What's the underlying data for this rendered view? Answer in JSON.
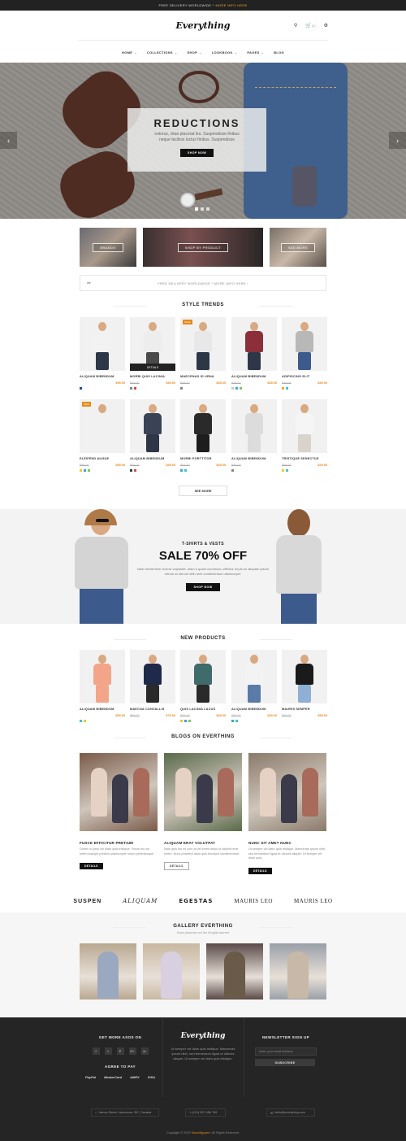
{
  "topbar": {
    "text": "FREE DELIVERY WORLDWIDE *",
    "link": "MORE INFO HERE"
  },
  "header": {
    "logo": "Everything",
    "cart_count": "(0)"
  },
  "nav": {
    "items": [
      {
        "label": "HOME",
        "caret": "⌄"
      },
      {
        "label": "COLLECTIONS",
        "caret": "⌄"
      },
      {
        "label": "SHOP",
        "caret": "⌄"
      },
      {
        "label": "LOOKBOOK",
        "caret": "⌄"
      },
      {
        "label": "PAGES",
        "caret": "⌄"
      },
      {
        "label": "BLOG",
        "caret": ""
      }
    ]
  },
  "hero": {
    "title": "REDUCTIONS",
    "subtitle": "ontorus, vitae placerat leo. Suspendisse finibus neque facilisis luctus finibus. Suspendisse",
    "button": "SHOP NOW"
  },
  "banners": [
    "BRANDS",
    "SHOP BY PRODUCT",
    "SEE MORE"
  ],
  "freebar": "FREE DELIVERY WORLDWIDE * MORE INFO HERE ›",
  "style_trends": {
    "title": "STYLE TRENDS",
    "products": [
      {
        "name": "ALIQUAM BIBENDUM",
        "old": "",
        "price": "$99.00",
        "badge": "",
        "swatches": [
          "#1f4aa8"
        ],
        "shirt": "#f2f2f2",
        "pants": "#2d3748"
      },
      {
        "name": "MORBI QUIS LACINIA",
        "old": "$49.00",
        "price": "$39.00",
        "badge": "",
        "swatches": [
          "#888888",
          "#d14b4b"
        ],
        "shirt": "#ededed",
        "pants": "#4a4a4a",
        "details": "DETAILS"
      },
      {
        "name": "MAECENAS ID URNA",
        "old": "$49.00",
        "price": "$39.00",
        "badge": "SALE",
        "swatches": [
          "#888888"
        ],
        "shirt": "#e8e8e8",
        "pants": "#2d3748"
      },
      {
        "name": "ALIQUAM BIBENDUM",
        "old": "$49.00",
        "price": "$39.00",
        "badge": "",
        "swatches": [
          "#cccccc",
          "#3fa3d3",
          "#7ac76d"
        ],
        "shirt": "#8c2f3b",
        "pants": "#2d3748"
      },
      {
        "name": "ADIPISCING ELIT",
        "old": "$49.00",
        "price": "$39.00",
        "badge": "",
        "swatches": [
          "#f0a830",
          "#3fc5c5"
        ],
        "shirt": "#b8b8b8",
        "pants": "#3d5a8c"
      },
      {
        "name": "ELEIFEND AUGUE",
        "old": "$99.00",
        "price": "$99.00",
        "badge": "NEW",
        "swatches": [
          "#f0c930",
          "#3fa3d3",
          "#7ac76d"
        ],
        "shirt": "#f1f1f1",
        "pants": "#f1f1f1"
      },
      {
        "name": "ALIQUAM BIBENDUM",
        "old": "$49.00",
        "price": "$39.00",
        "badge": "",
        "swatches": [
          "#3a3a3a",
          "#d14b4b"
        ],
        "shirt": "#3a4256",
        "pants": "#2d3748"
      },
      {
        "name": "MORBI PORTTITOR",
        "old": "$49.00",
        "price": "$39.00",
        "badge": "",
        "swatches": [
          "#3fa3d3",
          "#3fc5c5"
        ],
        "shirt": "#2a2a2a",
        "pants": "#1e1e1e"
      },
      {
        "name": "ALIQUAM BIBENDUM",
        "old": "$49.00",
        "price": "",
        "badge": "",
        "swatches": [
          "#888888"
        ],
        "shirt": "#dcdcdc",
        "pants": "#dcdcdc"
      },
      {
        "name": "TRISTIQUE SENECTUS",
        "old": "$49.00",
        "price": "$29.00",
        "badge": "",
        "swatches": [
          "#f0c930",
          "#3fc5c5"
        ],
        "shirt": "#f5f5f5",
        "pants": "#d8d4cc"
      }
    ],
    "see_more": "SEE MORE"
  },
  "sale": {
    "kicker": "T-SHIRTS & VESTS",
    "title": "SALE 70% OFF",
    "text": "Nam elementum viverra vulputate, diam a quam commodo, efficitur turpis eu aliquam ipsum rutrum at nisl vel nibh sem condimentum ullamcorper.",
    "button": "SHOP NOW"
  },
  "new_products": {
    "title": "NEW PRODUCTS",
    "products": [
      {
        "name": "ALIQUAM BIBENDUM",
        "old": "",
        "price": "$99.00",
        "swatches": [
          "#3fc5c5",
          "#f0c930"
        ],
        "shirt": "#f3a58a",
        "pants": "#f3a58a"
      },
      {
        "name": "MAECNA CONVALLIS",
        "old": "$99.00",
        "price": "$79.00",
        "swatches": [],
        "shirt": "#1f2a4a",
        "pants": "#2a2a2a"
      },
      {
        "name": "QUIS LACINIA LACUS",
        "old": "$49.00",
        "price": "$39.00",
        "swatches": [
          "#f0c930",
          "#3fa3d3",
          "#7ac76d"
        ],
        "shirt": "#3f6b6a",
        "pants": "#2a2a2a"
      },
      {
        "name": "ALIQUAM BIBENDUM",
        "old": "$49.00",
        "price": "$39.00",
        "swatches": [
          "#3fa3d3",
          "#3fc5c5"
        ],
        "shirt": "#f3f3f3",
        "pants": "#5a7aa8"
      },
      {
        "name": "MAURIS SEMPER",
        "old": "$49.00",
        "price": "$59.00",
        "swatches": [],
        "shirt": "#1a1a1a",
        "pants": "#8eb0d4"
      }
    ]
  },
  "blogs": {
    "title": "BLOGS ON EVERTHING",
    "posts": [
      {
        "title": "FUSCE EFFICITUR PRETIUM",
        "text": "Donec in justo vel diam quis tristique. Fusce leo vel lorem suscipit pretium ullamcorper lorem pellentesque",
        "button": "DETAILS",
        "dark": true,
        "bg": "#7a5a48"
      },
      {
        "title": "ALIQUAM ERAT VOLUTPAT",
        "text": "Nam quis leo mi cum at vel lorem tellus id lobortis erat lorem. Nunc pharetra diam quis tincidunt condimentum.",
        "button": "DETAILS",
        "dark": false,
        "bg": "#5a6a4a"
      },
      {
        "title": "NUNC SIT AMET NUNC",
        "text": "Ut semper vel diam quis tristique. Maecenas ipsum nibh, sed fermentum ligula et ultrices aliquet. Ut semper vel diam quis.",
        "button": "DETAILS",
        "dark": true,
        "bg": "#8a7a6a"
      }
    ]
  },
  "brands": [
    "SUSPEN",
    "ALIQUAM",
    "EGESTAS",
    "MAURIS LEO",
    "MAURIS LEO"
  ],
  "gallery": {
    "title": "GALLERY EVERTHING",
    "subtitle": "Nunc placerat vel leo fringilla laoreet",
    "bgs": [
      "#b8a890",
      "#c8b8a0",
      "#5a4a48",
      "#9aa0a8"
    ]
  },
  "footer": {
    "asos": "GET MORE ASOS ON",
    "social": [
      "f",
      "t",
      "P",
      "G+",
      "in"
    ],
    "pay_title": "AGREE TO PAY",
    "pays": [
      "PayPal",
      "MasterCard",
      "AMEX",
      "VISA"
    ],
    "logo": "Everything",
    "about": "Ut semper vel diam quis tristique. Maecenas ipsum nibh, sed fermentum ligula et ultrices aliquet. Ut semper vel diam quis tristique.",
    "newsletter": "NEWSLETTER SIGN UP",
    "email_placeholder": "enter your email address",
    "subscribe": "SUBSCRIBE",
    "address": "James Street, Vancouver, BC, Canada",
    "phone": "+ (410) 922 456 789",
    "email": "hello@everything.com",
    "copyright": "Copyright © 2015",
    "author": "SarahNguyen",
    "rights": ". All Rights Reserved."
  }
}
